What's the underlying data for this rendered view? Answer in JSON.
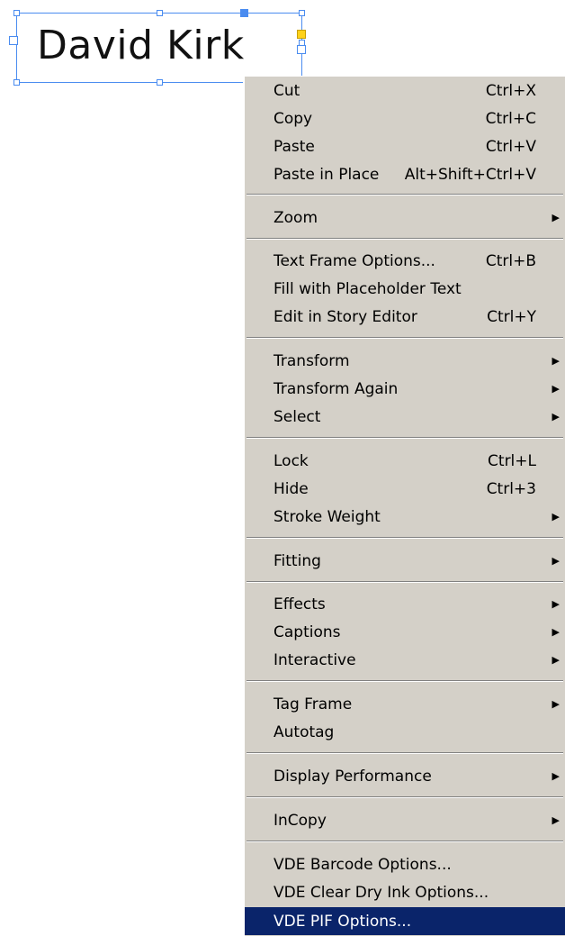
{
  "canvas": {
    "frame_text": "David Kirk"
  },
  "menu": {
    "items": [
      {
        "label": "Cut",
        "shortcut": "Ctrl+X"
      },
      {
        "label": "Copy",
        "shortcut": "Ctrl+C"
      },
      {
        "label": "Paste",
        "shortcut": "Ctrl+V"
      },
      {
        "label": "Paste in Place",
        "shortcut": "Alt+Shift+Ctrl+V"
      },
      {
        "label": "Zoom",
        "submenu": true
      },
      {
        "label": "Text Frame Options...",
        "shortcut": "Ctrl+B"
      },
      {
        "label": "Fill with Placeholder Text"
      },
      {
        "label": "Edit in Story Editor",
        "shortcut": "Ctrl+Y"
      },
      {
        "label": "Transform",
        "submenu": true
      },
      {
        "label": "Transform Again",
        "submenu": true
      },
      {
        "label": "Select",
        "submenu": true
      },
      {
        "label": "Lock",
        "shortcut": "Ctrl+L"
      },
      {
        "label": "Hide",
        "shortcut": "Ctrl+3"
      },
      {
        "label": "Stroke Weight",
        "submenu": true
      },
      {
        "label": "Fitting",
        "submenu": true
      },
      {
        "label": "Effects",
        "submenu": true
      },
      {
        "label": "Captions",
        "submenu": true
      },
      {
        "label": "Interactive",
        "submenu": true
      },
      {
        "label": "Tag Frame",
        "submenu": true
      },
      {
        "label": "Autotag"
      },
      {
        "label": "Display Performance",
        "submenu": true
      },
      {
        "label": "InCopy",
        "submenu": true
      },
      {
        "label": "VDE Barcode Options..."
      },
      {
        "label": "VDE Clear Dry Ink Options..."
      },
      {
        "label": "VDE PIF Options...",
        "highlighted": true
      }
    ],
    "submenu_arrow_icon": "triangle-right-icon"
  },
  "colors": {
    "selection_frame": "#4a8cf0",
    "menu_background": "#d4d0c8",
    "highlight": "#0a246a"
  }
}
